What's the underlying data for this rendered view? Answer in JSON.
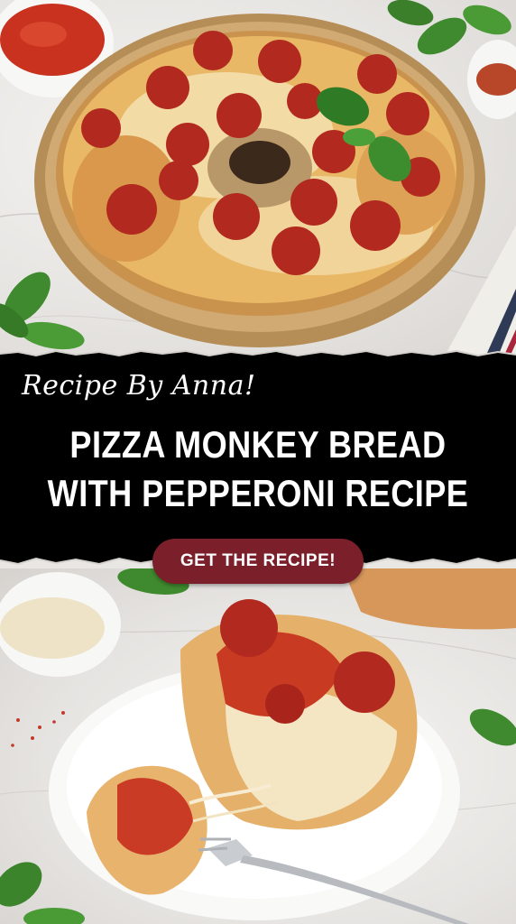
{
  "header": {
    "signature": "Recipe By Anna!",
    "title_line1": "PIZZA MONKEY BREAD",
    "title_line2": "WITH PEPPERONI RECIPE"
  },
  "cta": {
    "label": "GET THE RECIPE!"
  },
  "colors": {
    "band": "#000000",
    "cta_background": "#7b1f2b",
    "text": "#ffffff"
  }
}
